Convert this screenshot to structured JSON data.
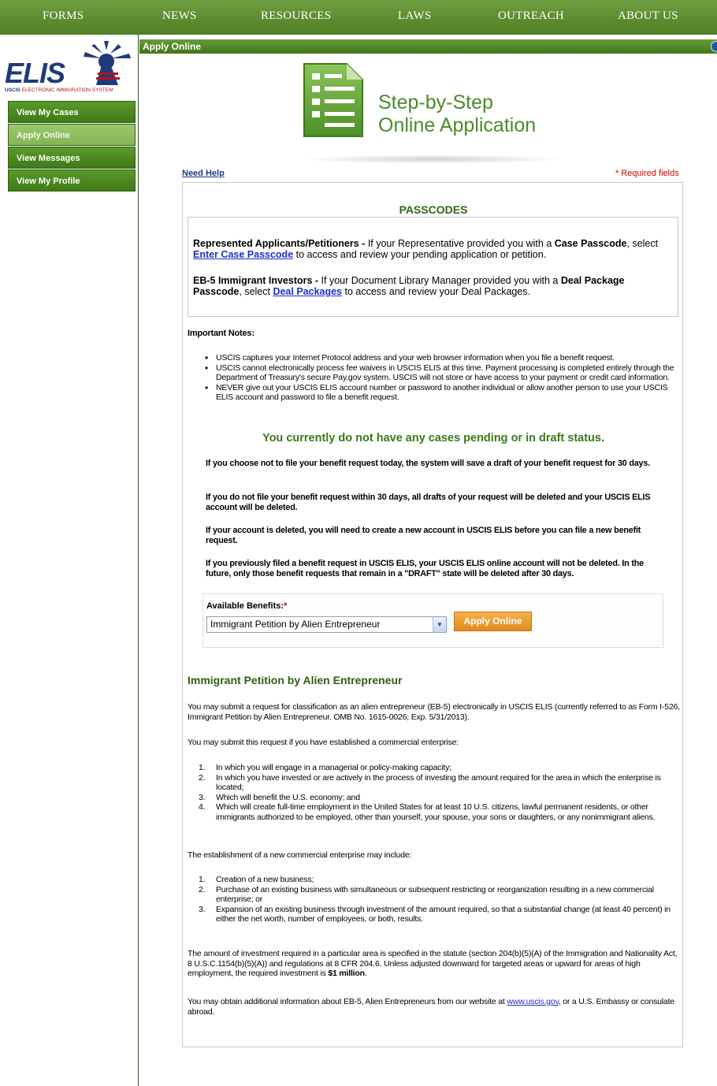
{
  "topnav": [
    "FORMS",
    "NEWS",
    "RESOURCES",
    "LAWS",
    "OUTREACH",
    "ABOUT US"
  ],
  "logo": {
    "word": "ELIS",
    "tagline_bold": "USCIS",
    "tagline_rest": "ELECTRONIC IMMIGRATION SYSTEM"
  },
  "sidebar": {
    "items": [
      {
        "label": "View My Cases"
      },
      {
        "label": "Apply Online"
      },
      {
        "label": "View Messages"
      },
      {
        "label": "View My Profile"
      }
    ]
  },
  "header": {
    "title": "Apply Online"
  },
  "banner": {
    "line1": "Step-by-Step",
    "line2": "Online Application"
  },
  "help": {
    "need_help": "Need Help",
    "required": "* Required fields"
  },
  "passcodes": {
    "title": "PASSCODES",
    "p1_bold": "Represented Applicants/Petitioners - ",
    "p1_a": "If your Representative provided you with a ",
    "p1_b": "Case Passcode",
    "p1_c": ", select ",
    "p1_link": "Enter Case Passcode",
    "p1_d": " to access and review your pending application or petition.",
    "p2_bold": "EB-5 Immigrant Investors - ",
    "p2_a": "If your Document Library Manager provided you with a ",
    "p2_b": "Deal Package Passcode",
    "p2_c": ", select ",
    "p2_link": "Deal Packages",
    "p2_d": " to access and review your Deal Packages."
  },
  "notes": {
    "title": "Important Notes:",
    "items": [
      "USCIS captures your Internet Protocol address and your web browser information when you file a benefit request.",
      "USCIS cannot electronically process fee waivers in USCIS ELIS at this time. Payment processing is completed entirely through the Department of Treasury's secure Pay.gov system. USCIS will not store or have access to your payment or credit card information.",
      "NEVER give out your USCIS ELIS account number or password to another individual or allow another person to use your USCIS ELIS account and password to file a benefit request."
    ]
  },
  "status": {
    "no_cases": "You currently do not have any cases pending or in draft status."
  },
  "paras": [
    "If you choose not to file your benefit request today, the system will save a draft of your benefit request for 30 days.",
    "If you do not file your benefit request within 30 days, all drafts of your request will be deleted and your USCIS ELIS account will be deleted.",
    "If your account is deleted, you will need to create a new account in USCIS ELIS before you can file a new benefit request.",
    "If you previously filed a benefit request in USCIS ELIS, your USCIS ELIS online account will not be deleted. In the future, only those benefit requests that remain in a \"DRAFT\" state will be deleted after 30 days."
  ],
  "benefits": {
    "label": "Available Benefits:",
    "required_mark": "*",
    "selected": "Immigrant Petition by Alien Entrepreneur",
    "apply_label": "Apply Online"
  },
  "section": {
    "title": "Immigrant Petition by Alien Entrepreneur",
    "intro": "You may submit a request for classification as an alien entrepreneur (EB-5) electronically in USCIS ELIS (currently referred to as Form I-526, Immigrant Petition by Alien Entrepreneur. OMB No. 1615-0026; Exp. 5/31/2013).",
    "lead1": "You may submit this request if you have established a commercial enterprise:",
    "list1": [
      {
        "n": "1.",
        "t": "In which you will engage in a managerial or policy-making capacity;"
      },
      {
        "n": "2.",
        "t": "In which you have invested or are actively in the process of investing the amount required for the area in which the enterprise is located;"
      },
      {
        "n": "3.",
        "t": "Which will benefit the U.S. economy; and"
      },
      {
        "n": "4.",
        "t": "Which will create full-time employment in the United States for at least 10 U.S. citizens, lawful permanent residents, or other immigrants authorized to be employed, other than yourself, your spouse, your sons or daughters, or any nonimmigrant aliens."
      }
    ],
    "lead2": "The establishment of a new commercial enterprise may include:",
    "list2": [
      {
        "n": "1.",
        "t": "Creation of a new business;"
      },
      {
        "n": "2.",
        "t": "Purchase of an existing business with simultaneous or subsequent restricting or reorganization resulting in a new commercial enterprise; or"
      },
      {
        "n": "3.",
        "t": "Expansion of an existing business through investment of the amount required, so that a substantial change (at least 40 percent) in either the net worth, number of employees, or both, results."
      }
    ],
    "amount_text": "The amount of investment required in a particular area is specified in the statute (section 204(b)(5)(A) of the Immigration and Nationality Act, 8 U.S.C.1154(b)(5)(A)) and regulations at 8 CFR 204.6. Unless adjusted downward for targeted areas or upward for areas of high employment, the required investment is ",
    "amount_bold": "$1 million",
    "amount_end": ".",
    "info_a": "You may obtain additional information about EB-5, Alien Entrepreneurs from our website at ",
    "info_link": "www.uscis.gov",
    "info_b": ", or a U.S. Embassy or consulate abroad."
  }
}
